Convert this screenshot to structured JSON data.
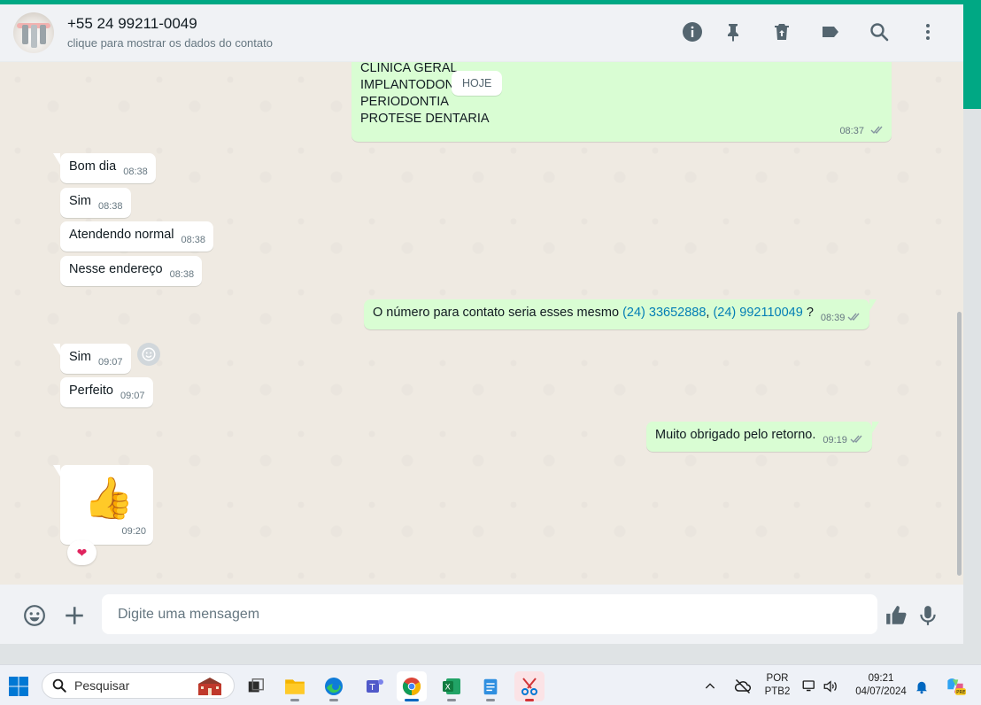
{
  "header": {
    "contact_name": "+55 24 99211-0049",
    "contact_subtitle": "clique para mostrar os dados do contato",
    "icons": [
      "info-icon",
      "pin-icon",
      "delete-icon",
      "label-icon",
      "search-icon",
      "menu-icon"
    ]
  },
  "day_label": "HOJE",
  "messages": {
    "m1": {
      "lines": [
        "CLINICA GERAL",
        "IMPLANTODON",
        "PERIODONTIA",
        "PROTESE DENTARIA"
      ],
      "time": "08:37"
    },
    "m2": {
      "text": "Bom dia",
      "time": "08:38"
    },
    "m3": {
      "text": "Sim",
      "time": "08:38"
    },
    "m4": {
      "text": "Atendendo normal",
      "time": "08:38"
    },
    "m5": {
      "text": "Nesse endereço",
      "time": "08:38"
    },
    "m6": {
      "text_before": "O número para contato seria esses mesmo ",
      "phone1": "(24) 33652888",
      "sep": ", ",
      "phone2": "(24) 992110049",
      "text_after": " ?",
      "time": "08:39"
    },
    "m7": {
      "text": "Sim",
      "time": "09:07"
    },
    "m8": {
      "text": "Perfeito",
      "time": "09:07"
    },
    "m9": {
      "text": "Muito obrigado pelo retorno.",
      "time": "09:19"
    },
    "m10": {
      "emoji": "👍",
      "time": "09:20",
      "reaction": "❤"
    }
  },
  "composer": {
    "placeholder": "Digite uma mensagem"
  },
  "taskbar": {
    "search_label": "Pesquisar",
    "lang_top": "POR",
    "lang_bottom": "PTB2",
    "time": "09:21",
    "date": "04/07/2024"
  },
  "colors": {
    "accent": "#00a884",
    "outgoing_bubble": "#d9fdd3",
    "incoming_bubble": "#ffffff",
    "chat_background": "#efeae2",
    "link": "#027eb5",
    "read_check": "#53bdeb"
  }
}
